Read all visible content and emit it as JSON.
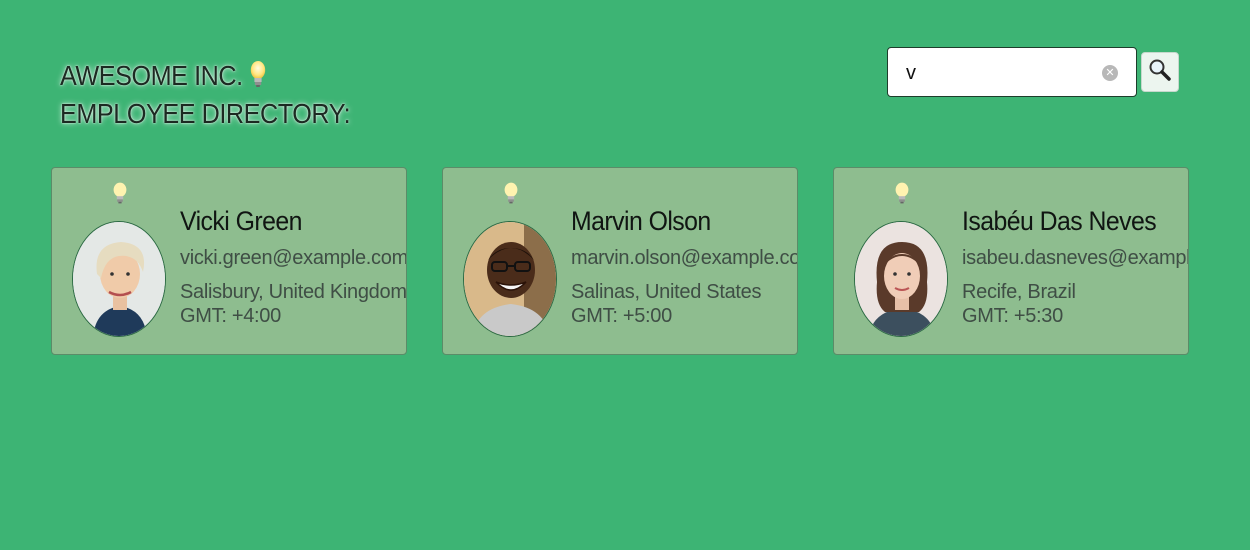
{
  "header": {
    "line1": "AWESOME INC.",
    "line2": "EMPLOYEE DIRECTORY:",
    "bulb_icon": "lightbulb-icon"
  },
  "search": {
    "value": "v",
    "placeholder": "",
    "clear_icon": "clear-icon",
    "button_icon": "magnifier-icon"
  },
  "employees": [
    {
      "name": "Vicki Green",
      "email": "vicki.green@example.com",
      "location": "Salisbury, United Kingdom",
      "gmt": "GMT: +4:00"
    },
    {
      "name": "Marvin Olson",
      "email": "marvin.olson@example.com",
      "location": "Salinas, United States",
      "gmt": "GMT: +5:00"
    },
    {
      "name": "Isabéu Das Neves",
      "email": "isabeu.dasneves@example.com",
      "location": "Recife, Brazil",
      "gmt": "GMT: +5:30"
    }
  ],
  "colors": {
    "background": "#3db474",
    "card": "#8ebd8f"
  }
}
